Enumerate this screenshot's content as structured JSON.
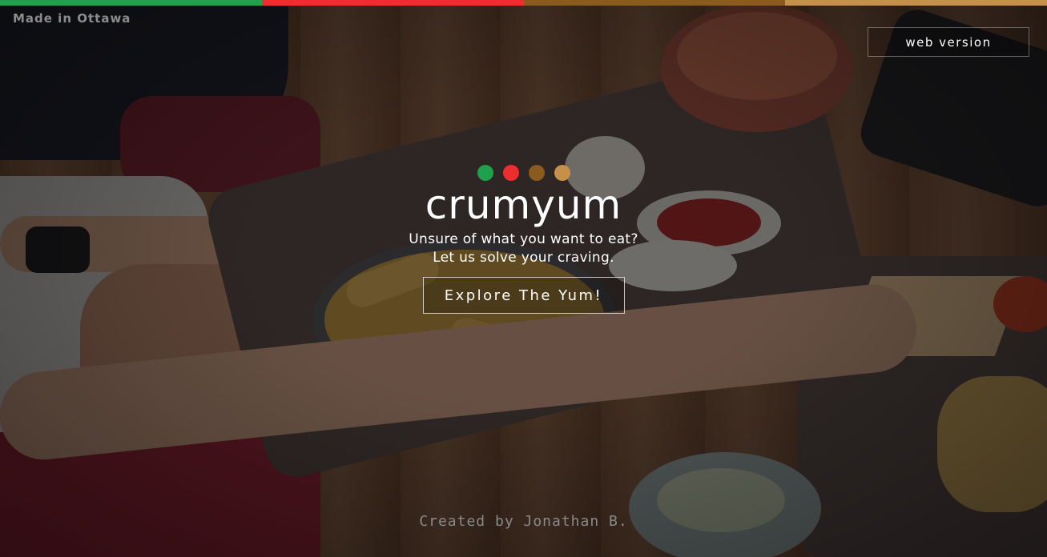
{
  "top_stripe_colors": [
    "#1fa04a",
    "#ee2e2e",
    "#8a5a1f",
    "#c7904a"
  ],
  "header": {
    "made_in": "Made in Ottawa",
    "web_version_label": "web version"
  },
  "hero": {
    "logo_dots_colors": [
      "#1fa04a",
      "#ee2e2e",
      "#8a5a1f",
      "#c7904a"
    ],
    "logo_text": "crumyum",
    "tagline_line1": "Unsure of what you want to eat?",
    "tagline_line2": "Let us solve your craving.",
    "cta_label": "Explore The Yum!"
  },
  "footer": {
    "credit": "Created by Jonathan B."
  }
}
